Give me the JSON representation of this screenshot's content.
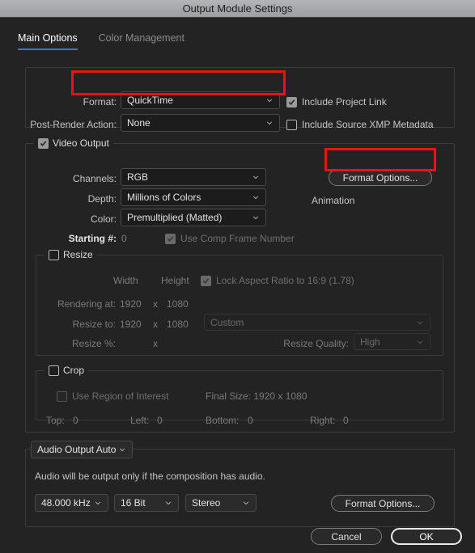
{
  "window": {
    "title": "Output Module Settings"
  },
  "tabs": [
    {
      "label": "Main Options",
      "active": true
    },
    {
      "label": "Color Management",
      "active": false
    }
  ],
  "format_group": {
    "format_label": "Format:",
    "format_value": "QuickTime",
    "post_render_label": "Post-Render Action:",
    "post_render_value": "None",
    "include_project_link": "Include Project Link",
    "include_xmp": "Include Source XMP Metadata"
  },
  "video_output": {
    "title": "Video Output",
    "channels_label": "Channels:",
    "channels_value": "RGB",
    "depth_label": "Depth:",
    "depth_value": "Millions of Colors",
    "color_label": "Color:",
    "color_value": "Premultiplied (Matted)",
    "starting_label": "Starting #:",
    "starting_value": "0",
    "use_comp_frame_number": "Use Comp Frame Number",
    "format_options_button": "Format Options...",
    "codec_name": "Animation"
  },
  "resize": {
    "title": "Resize",
    "width_header": "Width",
    "height_header": "Height",
    "lock_aspect": "Lock Aspect Ratio to 16:9 (1.78)",
    "rendering_at_label": "Rendering at:",
    "rendering_width": "1920",
    "rendering_x": "x",
    "rendering_height": "1080",
    "resize_to_label": "Resize to:",
    "resize_width": "1920",
    "resize_x": "x",
    "resize_height": "1080",
    "preset_value": "Custom",
    "resize_pct_label": "Resize %:",
    "resize_pct_x": "x",
    "quality_label": "Resize Quality:",
    "quality_value": "High"
  },
  "crop": {
    "title": "Crop",
    "use_region": "Use Region of Interest",
    "final_size": "Final Size: 1920 x 1080",
    "top_label": "Top:",
    "top_value": "0",
    "left_label": "Left:",
    "left_value": "0",
    "bottom_label": "Bottom:",
    "bottom_value": "0",
    "right_label": "Right:",
    "right_value": "0"
  },
  "audio": {
    "title": "Audio Output Auto",
    "note": "Audio will be output only if the composition has audio.",
    "sample_rate": "48.000 kHz",
    "bit_depth": "16 Bit",
    "channels": "Stereo",
    "format_options_button": "Format Options..."
  },
  "footer": {
    "cancel": "Cancel",
    "ok": "OK"
  },
  "annotations": {
    "highlight_color": "#ee1111",
    "accent_color": "#2a7fd4"
  }
}
